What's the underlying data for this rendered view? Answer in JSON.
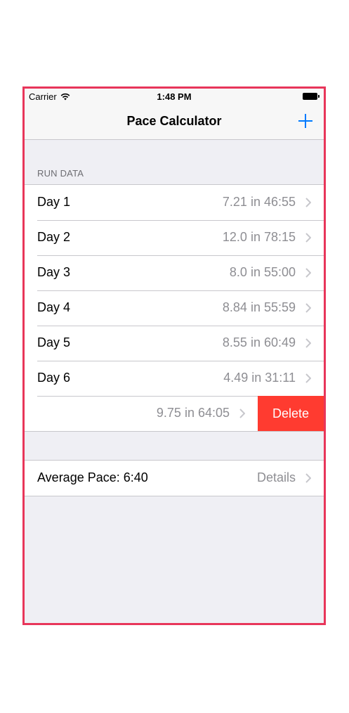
{
  "status_bar": {
    "carrier": "Carrier",
    "time": "1:48 PM",
    "wifi_icon": "wifi-icon",
    "battery_icon": "battery-icon"
  },
  "nav_bar": {
    "title": "Pace Calculator",
    "add_icon": "plus-icon",
    "tint": "#007aff"
  },
  "run_data": {
    "header": "RUN DATA",
    "rows": [
      {
        "title": "Day 1",
        "detail": "7.21 in 46:55"
      },
      {
        "title": "Day 2",
        "detail": "12.0 in 78:15"
      },
      {
        "title": "Day 3",
        "detail": "8.0 in 55:00"
      },
      {
        "title": "Day 4",
        "detail": "8.84 in 55:59"
      },
      {
        "title": "Day 5",
        "detail": "8.55 in 60:49"
      },
      {
        "title": "Day 6",
        "detail": "4.49 in 31:11"
      }
    ],
    "swiped_row": {
      "detail": "9.75 in 64:05",
      "delete_label": "Delete",
      "delete_color": "#ff3b30"
    }
  },
  "summary": {
    "average_label": "Average Pace: 6:40",
    "details_label": "Details"
  }
}
